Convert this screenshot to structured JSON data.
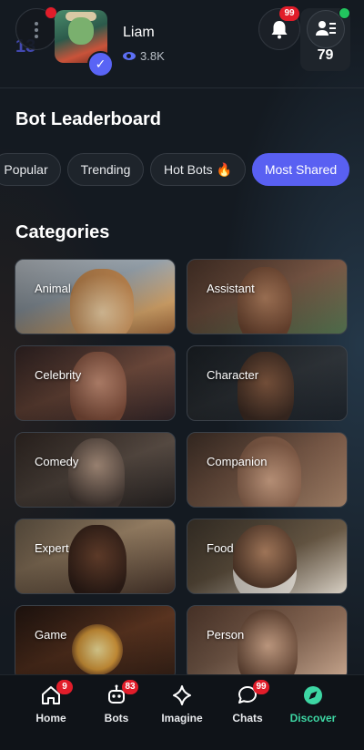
{
  "header": {
    "faded_number": "13",
    "username": "Liam",
    "views": "3.8K",
    "notifications_count": "99",
    "profile_count": "79"
  },
  "leaderboard": {
    "title": "Bot Leaderboard",
    "chips": [
      "Popular",
      "Trending",
      "Hot Bots 🔥",
      "Most Shared"
    ],
    "active_chip": "Most Shared"
  },
  "categories": {
    "title": "Categories",
    "items": [
      "Animal",
      "Assistant",
      "Celebrity",
      "Character",
      "Comedy",
      "Companion",
      "Expert",
      "Food",
      "Game",
      "Person"
    ]
  },
  "bottom_nav": {
    "items": [
      {
        "label": "Home",
        "badge": "9",
        "icon": "home-icon"
      },
      {
        "label": "Bots",
        "badge": "83",
        "icon": "bot-icon"
      },
      {
        "label": "Imagine",
        "badge": "",
        "icon": "sparkle-icon"
      },
      {
        "label": "Chats",
        "badge": "99",
        "icon": "chat-icon"
      },
      {
        "label": "Discover",
        "badge": "",
        "icon": "compass-icon"
      }
    ],
    "active": "Discover"
  },
  "colors": {
    "accent": "#5960f2",
    "discover_active": "#3dd6a3",
    "badge_red": "#e11d2a",
    "online_green": "#22c55e"
  }
}
